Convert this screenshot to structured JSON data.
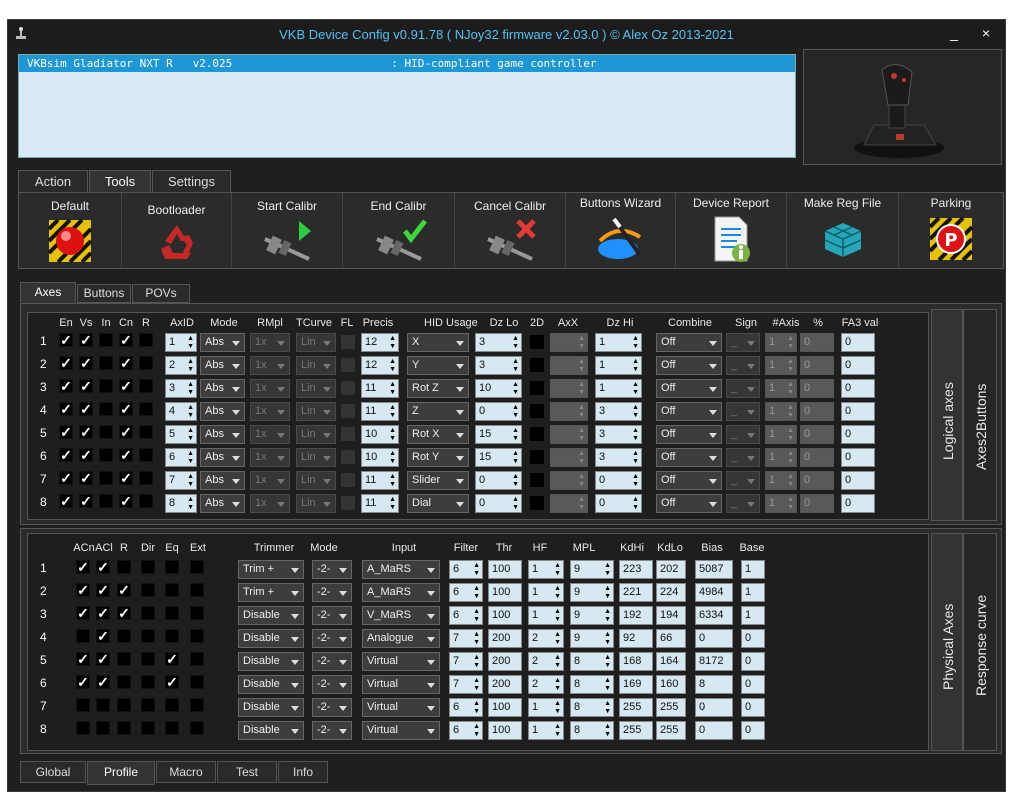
{
  "window": {
    "title": "VKB Device Config v0.91.78 ( NJoy32 firmware v2.03.0 ) © Alex Oz 2013-2021",
    "min_label": "_",
    "close_label": "×"
  },
  "device": {
    "selected_row": "VKBsim Gladiator NXT R   v2.025                        : HID-compliant game controller"
  },
  "main_tabs": [
    {
      "label": "Action"
    },
    {
      "label": "Tools"
    },
    {
      "label": "Settings"
    }
  ],
  "tools": [
    {
      "label": "Default",
      "icon": "red-button-icon"
    },
    {
      "label": "Bootloader",
      "icon": "recycle-icon"
    },
    {
      "label": "Start Calibr",
      "icon": "caliper-play-icon"
    },
    {
      "label": "End Calibr",
      "icon": "caliper-check-icon"
    },
    {
      "label": "Cancel Calibr",
      "icon": "caliper-cancel-icon"
    },
    {
      "label": "Buttons Wizard",
      "icon": "wizard-icon"
    },
    {
      "label": "Device Report",
      "icon": "report-icon"
    },
    {
      "label": "Make Reg File",
      "icon": "registry-icon"
    },
    {
      "label": "Parking",
      "icon": "parking-icon"
    }
  ],
  "sub_tabs": [
    {
      "label": "Axes"
    },
    {
      "label": "Buttons"
    },
    {
      "label": "POVs"
    }
  ],
  "logical": {
    "headers": [
      "En",
      "Vs",
      "In",
      "Cn",
      "R",
      "AxID",
      "Mode",
      "RMpl",
      "TCurve",
      "FL",
      "Precis",
      "HID Usage",
      "Dz Lo",
      "2D",
      "AxX",
      "Dz Hi",
      "Combine",
      "Sign",
      "#Axis",
      "%",
      "FA3 val"
    ],
    "side_tabs": [
      "Logical axes",
      "Axes2Buttons"
    ],
    "rows": [
      {
        "n": "1",
        "en": true,
        "vs": true,
        "in": false,
        "cn": true,
        "r": false,
        "axid": "1",
        "mode": "Abs",
        "rmpl": "1x",
        "tcurve": "Lin",
        "precis": "12",
        "hid": "X",
        "dzlo": "3",
        "dzhi": "1",
        "combine": "Off",
        "sign": "_",
        "axis": "1",
        "pct": "0",
        "fa3": "0"
      },
      {
        "n": "2",
        "en": true,
        "vs": true,
        "in": false,
        "cn": true,
        "r": false,
        "axid": "2",
        "mode": "Abs",
        "rmpl": "1x",
        "tcurve": "Lin",
        "precis": "12",
        "hid": "Y",
        "dzlo": "3",
        "dzhi": "1",
        "combine": "Off",
        "sign": "_",
        "axis": "1",
        "pct": "0",
        "fa3": "0"
      },
      {
        "n": "3",
        "en": true,
        "vs": true,
        "in": false,
        "cn": true,
        "r": false,
        "axid": "3",
        "mode": "Abs",
        "rmpl": "1x",
        "tcurve": "Lin",
        "precis": "11",
        "hid": "Rot Z",
        "dzlo": "10",
        "dzhi": "1",
        "combine": "Off",
        "sign": "_",
        "axis": "1",
        "pct": "0",
        "fa3": "0"
      },
      {
        "n": "4",
        "en": true,
        "vs": true,
        "in": false,
        "cn": true,
        "r": false,
        "axid": "4",
        "mode": "Abs",
        "rmpl": "1x",
        "tcurve": "Lin",
        "precis": "11",
        "hid": "Z",
        "dzlo": "0",
        "dzhi": "3",
        "combine": "Off",
        "sign": "_",
        "axis": "1",
        "pct": "0",
        "fa3": "0"
      },
      {
        "n": "5",
        "en": true,
        "vs": true,
        "in": false,
        "cn": true,
        "r": false,
        "axid": "5",
        "mode": "Abs",
        "rmpl": "1x",
        "tcurve": "Lin",
        "precis": "10",
        "hid": "Rot X",
        "dzlo": "15",
        "dzhi": "3",
        "combine": "Off",
        "sign": "_",
        "axis": "1",
        "pct": "0",
        "fa3": "0"
      },
      {
        "n": "6",
        "en": true,
        "vs": true,
        "in": false,
        "cn": true,
        "r": false,
        "axid": "6",
        "mode": "Abs",
        "rmpl": "1x",
        "tcurve": "Lin",
        "precis": "10",
        "hid": "Rot Y",
        "dzlo": "15",
        "dzhi": "3",
        "combine": "Off",
        "sign": "_",
        "axis": "1",
        "pct": "0",
        "fa3": "0"
      },
      {
        "n": "7",
        "en": true,
        "vs": true,
        "in": false,
        "cn": true,
        "r": false,
        "axid": "7",
        "mode": "Abs",
        "rmpl": "1x",
        "tcurve": "Lin",
        "precis": "11",
        "hid": "Slider",
        "dzlo": "0",
        "dzhi": "0",
        "combine": "Off",
        "sign": "_",
        "axis": "1",
        "pct": "0",
        "fa3": "0"
      },
      {
        "n": "8",
        "en": true,
        "vs": true,
        "in": false,
        "cn": true,
        "r": false,
        "axid": "8",
        "mode": "Abs",
        "rmpl": "1x",
        "tcurve": "Lin",
        "precis": "11",
        "hid": "Dial",
        "dzlo": "0",
        "dzhi": "0",
        "combine": "Off",
        "sign": "_",
        "axis": "1",
        "pct": "0",
        "fa3": "0"
      }
    ]
  },
  "physical": {
    "headers": [
      "ACn",
      "ACl",
      "R",
      "Dir",
      "Eq",
      "Ext",
      "Trimmer",
      "Mode",
      "Input",
      "Filter",
      "Thr",
      "HF",
      "MPL",
      "KdHi",
      "KdLo",
      "Bias",
      "Base"
    ],
    "side_tabs": [
      "Physical Axes",
      "Response curve"
    ],
    "rows": [
      {
        "n": "1",
        "acn": true,
        "acl": true,
        "r": false,
        "dir": false,
        "eq": false,
        "ext": false,
        "trimmer": "Trim +",
        "mode": "-2-",
        "input": "A_MaRS",
        "filter": "6",
        "thr": "100",
        "hf": "1",
        "mpl": "9",
        "kdhi": "223",
        "kdlo": "202",
        "bias": "5087",
        "base": "1"
      },
      {
        "n": "2",
        "acn": true,
        "acl": true,
        "r": true,
        "dir": false,
        "eq": false,
        "ext": false,
        "trimmer": "Trim +",
        "mode": "-2-",
        "input": "A_MaRS",
        "filter": "6",
        "thr": "100",
        "hf": "1",
        "mpl": "9",
        "kdhi": "221",
        "kdlo": "224",
        "bias": "4984",
        "base": "1"
      },
      {
        "n": "3",
        "acn": true,
        "acl": true,
        "r": true,
        "dir": false,
        "eq": false,
        "ext": false,
        "trimmer": "Disable",
        "mode": "-2-",
        "input": "V_MaRS",
        "filter": "6",
        "thr": "100",
        "hf": "1",
        "mpl": "9",
        "kdhi": "192",
        "kdlo": "194",
        "bias": "6334",
        "base": "1"
      },
      {
        "n": "4",
        "acn": false,
        "acl": true,
        "r": false,
        "dir": false,
        "eq": false,
        "ext": false,
        "trimmer": "Disable",
        "mode": "-2-",
        "input": "Analogue",
        "filter": "7",
        "thr": "200",
        "hf": "2",
        "mpl": "9",
        "kdhi": "92",
        "kdlo": "66",
        "bias": "0",
        "base": "0"
      },
      {
        "n": "5",
        "acn": true,
        "acl": true,
        "r": false,
        "dir": false,
        "eq": true,
        "ext": false,
        "trimmer": "Disable",
        "mode": "-2-",
        "input": "Virtual",
        "filter": "7",
        "thr": "200",
        "hf": "2",
        "mpl": "8",
        "kdhi": "168",
        "kdlo": "164",
        "bias": "8172",
        "base": "0"
      },
      {
        "n": "6",
        "acn": true,
        "acl": true,
        "r": false,
        "dir": false,
        "eq": true,
        "ext": false,
        "trimmer": "Disable",
        "mode": "-2-",
        "input": "Virtual",
        "filter": "7",
        "thr": "200",
        "hf": "2",
        "mpl": "8",
        "kdhi": "169",
        "kdlo": "160",
        "bias": "8",
        "base": "0"
      },
      {
        "n": "7",
        "acn": false,
        "acl": false,
        "r": false,
        "dir": false,
        "eq": false,
        "ext": false,
        "trimmer": "Disable",
        "mode": "-2-",
        "input": "Virtual",
        "filter": "6",
        "thr": "100",
        "hf": "1",
        "mpl": "8",
        "kdhi": "255",
        "kdlo": "255",
        "bias": "0",
        "base": "0"
      },
      {
        "n": "8",
        "acn": false,
        "acl": false,
        "r": false,
        "dir": false,
        "eq": false,
        "ext": false,
        "trimmer": "Disable",
        "mode": "-2-",
        "input": "Virtual",
        "filter": "6",
        "thr": "100",
        "hf": "1",
        "mpl": "8",
        "kdhi": "255",
        "kdlo": "255",
        "bias": "0",
        "base": "0"
      }
    ]
  },
  "bottom_tabs": [
    {
      "label": "Global"
    },
    {
      "label": "Profile"
    },
    {
      "label": "Macro"
    },
    {
      "label": "Test"
    },
    {
      "label": "Info"
    }
  ]
}
